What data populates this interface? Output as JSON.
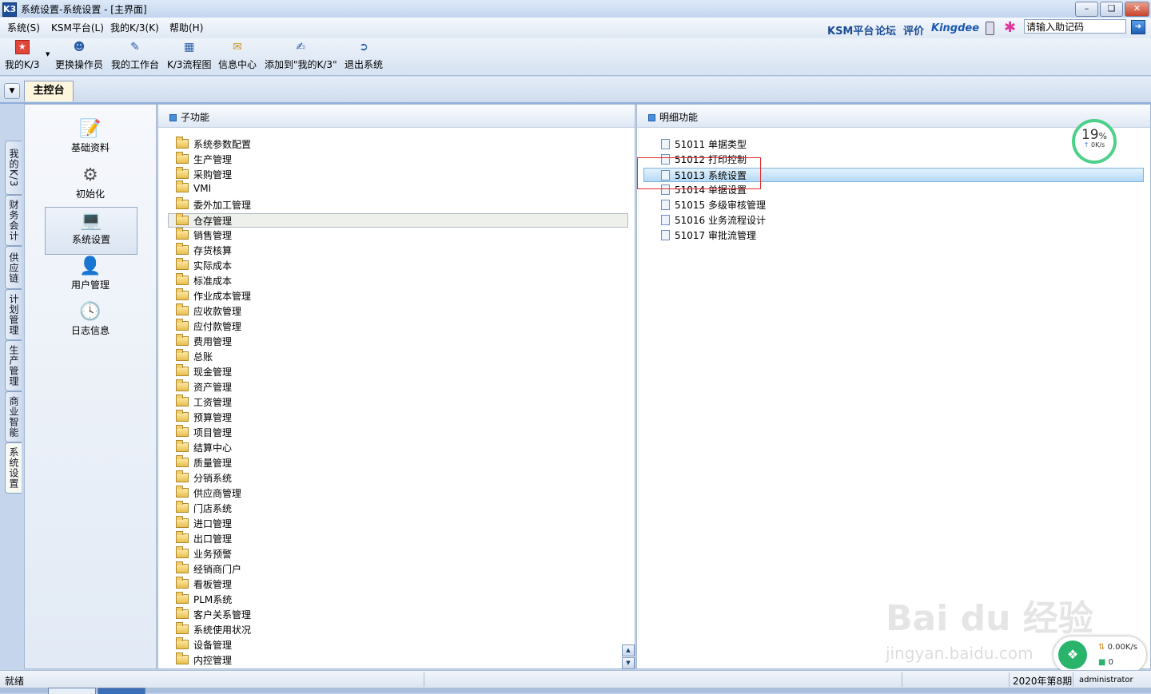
{
  "window": {
    "title": "系统设置-系统设置 - [主界面]",
    "app_icon": "K3"
  },
  "menu": {
    "items": [
      "系统(S)",
      "KSM平台(L)",
      "我的K/3(K)",
      "帮助(H)"
    ]
  },
  "brand": {
    "ksm": "KSM平台",
    "forum": "论坛",
    "review": "评价",
    "kingdee": "Kingdee"
  },
  "assist": {
    "placeholder": "请输入助记码",
    "value": "请输入助记码"
  },
  "toolbar": {
    "items": [
      "我的K/3",
      "更换操作员",
      "我的工作台",
      "K/3流程图",
      "信息中心",
      "添加到\"我的K/3\"",
      "退出系统"
    ]
  },
  "tabs": {
    "main": "主控台"
  },
  "vtabs": [
    "我的K/3",
    "财务会计",
    "供应链",
    "计划管理",
    "生产管理",
    "商业智能",
    "系统设置"
  ],
  "nav": {
    "items": [
      "基础资料",
      "初始化",
      "系统设置",
      "用户管理",
      "日志信息"
    ],
    "active": 2
  },
  "subfunc": {
    "title": "子功能",
    "items": [
      "系统参数配置",
      "生产管理",
      "采购管理",
      "VMI",
      "委外加工管理",
      "仓存管理",
      "销售管理",
      "存货核算",
      "实际成本",
      "标准成本",
      "作业成本管理",
      "应收款管理",
      "应付款管理",
      "费用管理",
      "总账",
      "现金管理",
      "资产管理",
      "工资管理",
      "预算管理",
      "项目管理",
      "结算中心",
      "质量管理",
      "分销系统",
      "供应商管理",
      "门店系统",
      "进口管理",
      "出口管理",
      "业务预警",
      "经销商门户",
      "看板管理",
      "PLM系统",
      "客户关系管理",
      "系统使用状况",
      "设备管理",
      "内控管理"
    ],
    "selected": 5
  },
  "detail": {
    "title": "明细功能",
    "items": [
      {
        "code": "51011",
        "name": "单据类型"
      },
      {
        "code": "51012",
        "name": "打印控制"
      },
      {
        "code": "51013",
        "name": "系统设置"
      },
      {
        "code": "51014",
        "name": "单据设置"
      },
      {
        "code": "51015",
        "name": "多级审核管理"
      },
      {
        "code": "51016",
        "name": "业务流程设计"
      },
      {
        "code": "51017",
        "name": "审批流管理"
      }
    ],
    "selected": 2
  },
  "speed": {
    "percent": "19",
    "unit": "%",
    "rate": "0K/s"
  },
  "net": {
    "rate": "0.00K/s",
    "count": "0"
  },
  "watermark": {
    "main": "Bai du 经验",
    "sub": "jingyan.baidu.com"
  },
  "status": {
    "ready": "就绪",
    "period": "2020年第8期",
    "user": "administrator"
  },
  "colors": {
    "accent": "#1c4d94",
    "selection": "#b5daf7",
    "highlight_box": "#e32b2b",
    "ring": "#4dd08a"
  }
}
